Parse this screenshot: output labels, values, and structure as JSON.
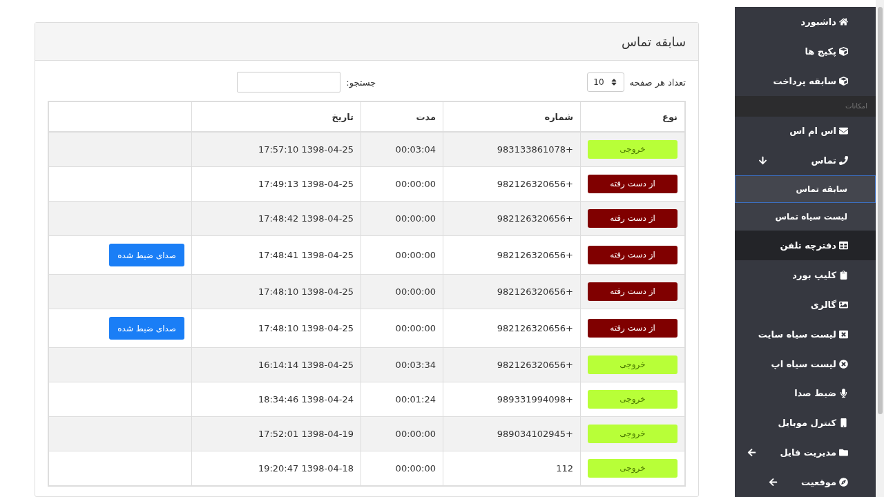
{
  "sidebar": {
    "items": [
      {
        "kind": "link",
        "label": "داشبورد",
        "hovered": false
      },
      {
        "kind": "link",
        "label": "پکیج ها",
        "hovered": false
      },
      {
        "kind": "link",
        "label": "سابقه پرداخت",
        "hovered": false
      },
      {
        "kind": "header",
        "label": "امکانات"
      },
      {
        "kind": "link",
        "label": "اس ام اس",
        "hovered": false
      },
      {
        "kind": "group",
        "label": "تماس",
        "expanded": true,
        "hovered": false
      },
      {
        "kind": "sub",
        "label": "سابقه تماس",
        "selected": true
      },
      {
        "kind": "sub",
        "label": "لیست سیاه تماس",
        "selected": false
      },
      {
        "kind": "link",
        "label": "دفترچه تلفن",
        "hovered": true
      },
      {
        "kind": "link",
        "label": "کلیپ بورد",
        "hovered": false
      },
      {
        "kind": "link",
        "label": "گالری",
        "hovered": false
      },
      {
        "kind": "link",
        "label": "لیست سیاه سایت",
        "hovered": false
      },
      {
        "kind": "link",
        "label": "لیست سیاه اپ",
        "hovered": false
      },
      {
        "kind": "link",
        "label": "ضبط صدا",
        "hovered": false
      },
      {
        "kind": "link",
        "label": "کنترل موبایل",
        "hovered": false
      },
      {
        "kind": "group",
        "label": "مدیریت فایل",
        "expanded": false,
        "hovered": false
      },
      {
        "kind": "group",
        "label": "موقعیت",
        "expanded": false,
        "hovered": false
      }
    ]
  },
  "panel": {
    "title": "سابقه تماس",
    "page_size": {
      "label": "تعداد هر صفحه",
      "value": "10"
    },
    "search": {
      "label": "جستجو:"
    },
    "table": {
      "columns": [
        "نوع",
        "شماره",
        "مدت",
        "تاریخ"
      ],
      "rows": [
        {
          "kind": "outgoing",
          "type": "خروجی",
          "number": "+983133861078",
          "duration": "00:03:04",
          "date": "1398-04-25 17:57:10"
        },
        {
          "kind": "missed",
          "type": "از دست رفته",
          "number": "+982126320656",
          "duration": "00:00:00",
          "date": "1398-04-25 17:49:13"
        },
        {
          "kind": "missed",
          "type": "از دست رفته",
          "number": "+982126320656",
          "duration": "00:00:00",
          "date": "1398-04-25 17:48:42"
        },
        {
          "kind": "missed",
          "type": "از دست رفته",
          "number": "+982126320656",
          "duration": "00:00:00",
          "date": "1398-04-25 17:48:41",
          "recording": "صدای ضبط شده"
        },
        {
          "kind": "missed",
          "type": "از دست رفته",
          "number": "+982126320656",
          "duration": "00:00:00",
          "date": "1398-04-25 17:48:10"
        },
        {
          "kind": "missed",
          "type": "از دست رفته",
          "number": "+982126320656",
          "duration": "00:00:00",
          "date": "1398-04-25 17:48:10",
          "recording": "صدای ضبط شده"
        },
        {
          "kind": "outgoing",
          "type": "خروجی",
          "number": "+982126320656",
          "duration": "00:03:34",
          "date": "1398-04-25 16:14:14"
        },
        {
          "kind": "outgoing",
          "type": "خروجی",
          "number": "+989331994098",
          "duration": "00:01:24",
          "date": "1398-04-24 18:34:46"
        },
        {
          "kind": "outgoing",
          "type": "خروجی",
          "number": "+989034102945",
          "duration": "00:00:00",
          "date": "1398-04-19 17:52:01"
        },
        {
          "kind": "outgoing",
          "type": "خروجی",
          "number": "112",
          "duration": "00:00:00",
          "date": "1398-04-18 19:20:47"
        }
      ]
    }
  }
}
